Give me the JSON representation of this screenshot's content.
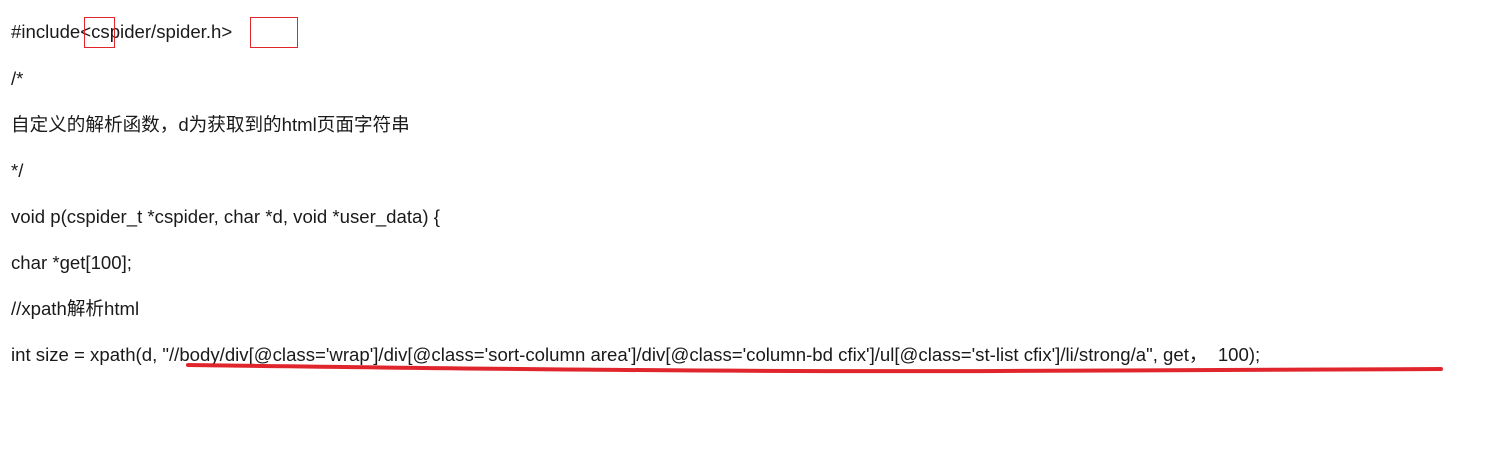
{
  "document": {
    "lines": [
      "#include<cspider/spider.h>",
      "/*",
      "自定义的解析函数，d为获取到的html页面字符串",
      "*/",
      "void p(cspider_t *cspider, char *d, void *user_data) {",
      "char *get[100];",
      "//xpath解析html",
      "int size = xpath(d, \"//body/div[@class='wrap']/div[@class='sort-column area']/div[@class='column-bd cfix']/ul[@class='st-list cfix']/li/strong/a\", get，  100);"
    ]
  },
  "annotations": {
    "color": "#e0262c",
    "boxes": [
      {
        "target": "<"
      },
      {
        "target": "h>"
      }
    ],
    "underline": {
      "target": "\"//body/div[@class='wrap']/div[@class='sort-column area']/div[@class='column-bd cfix']/ul[@class='st-list cfix']/li/strong/a\", get，"
    }
  }
}
